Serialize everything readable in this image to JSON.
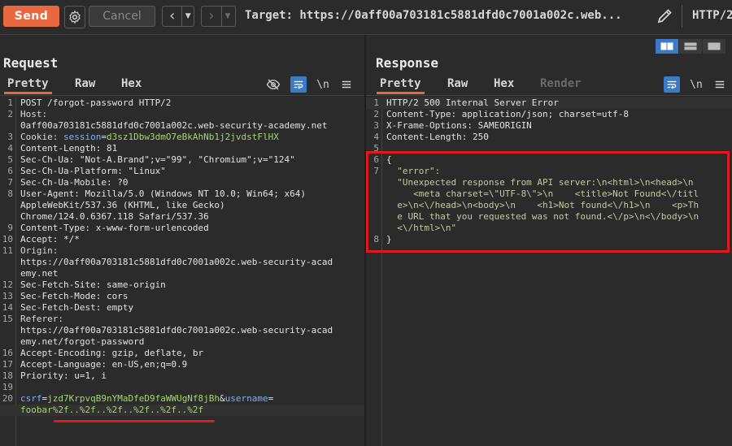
{
  "toolbar": {
    "send_label": "Send",
    "cancel_label": "Cancel",
    "target": "Target: https://0aff00a703181c5881dfd0c7001a002c.web...",
    "http_version": "HTTP/2"
  },
  "request": {
    "title": "Request",
    "tabs": [
      "Pretty",
      "Raw",
      "Hex"
    ],
    "newline_label": "\\n",
    "lines": [
      {
        "n": "1",
        "parts": [
          {
            "t": "POST /forgot-password HTTP/2",
            "c": "v"
          }
        ]
      },
      {
        "n": "2",
        "parts": [
          {
            "t": "Host:",
            "c": "k"
          }
        ]
      },
      {
        "n": "",
        "parts": [
          {
            "t": "0aff00a703181c5881dfd0c7001a002c.web-security-academy.net",
            "c": "v"
          }
        ]
      },
      {
        "n": "3",
        "parts": [
          {
            "t": "Cookie: ",
            "c": "k"
          },
          {
            "t": "session",
            "c": "b"
          },
          {
            "t": "=",
            "c": "v"
          },
          {
            "t": "d3sz1Dbw3dmO7eBkAhNb1j2jvdstFlHX",
            "c": "g"
          }
        ]
      },
      {
        "n": "4",
        "parts": [
          {
            "t": "Content-Length: 81",
            "c": "v"
          }
        ]
      },
      {
        "n": "5",
        "parts": [
          {
            "t": "Sec-Ch-Ua: \"Not-A.Brand\";v=\"99\", \"Chromium\";v=\"124\"",
            "c": "v"
          }
        ]
      },
      {
        "n": "6",
        "parts": [
          {
            "t": "Sec-Ch-Ua-Platform: \"Linux\"",
            "c": "v"
          }
        ]
      },
      {
        "n": "7",
        "parts": [
          {
            "t": "Sec-Ch-Ua-Mobile: ?0",
            "c": "v"
          }
        ]
      },
      {
        "n": "8",
        "parts": [
          {
            "t": "User-Agent: Mozilla/5.0 (Windows NT 10.0; Win64; x64)",
            "c": "v"
          }
        ]
      },
      {
        "n": "",
        "parts": [
          {
            "t": "AppleWebKit/537.36 (KHTML, like Gecko)",
            "c": "v"
          }
        ]
      },
      {
        "n": "",
        "parts": [
          {
            "t": "Chrome/124.0.6367.118 Safari/537.36",
            "c": "v"
          }
        ]
      },
      {
        "n": "9",
        "parts": [
          {
            "t": "Content-Type: x-www-form-urlencoded",
            "c": "v"
          }
        ]
      },
      {
        "n": "10",
        "parts": [
          {
            "t": "Accept: */*",
            "c": "v"
          }
        ]
      },
      {
        "n": "11",
        "parts": [
          {
            "t": "Origin:",
            "c": "k"
          }
        ]
      },
      {
        "n": "",
        "parts": [
          {
            "t": "https://0aff00a703181c5881dfd0c7001a002c.web-security-acad",
            "c": "v"
          }
        ]
      },
      {
        "n": "",
        "parts": [
          {
            "t": "emy.net",
            "c": "v"
          }
        ]
      },
      {
        "n": "12",
        "parts": [
          {
            "t": "Sec-Fetch-Site: same-origin",
            "c": "v"
          }
        ]
      },
      {
        "n": "13",
        "parts": [
          {
            "t": "Sec-Fetch-Mode: cors",
            "c": "v"
          }
        ]
      },
      {
        "n": "14",
        "parts": [
          {
            "t": "Sec-Fetch-Dest: empty",
            "c": "v"
          }
        ]
      },
      {
        "n": "15",
        "parts": [
          {
            "t": "Referer:",
            "c": "k"
          }
        ]
      },
      {
        "n": "",
        "parts": [
          {
            "t": "https://0aff00a703181c5881dfd0c7001a002c.web-security-acad",
            "c": "v"
          }
        ]
      },
      {
        "n": "",
        "parts": [
          {
            "t": "emy.net/forgot-password",
            "c": "v"
          }
        ]
      },
      {
        "n": "16",
        "parts": [
          {
            "t": "Accept-Encoding: gzip, deflate, br",
            "c": "v"
          }
        ]
      },
      {
        "n": "17",
        "parts": [
          {
            "t": "Accept-Language: en-US,en;q=0.9",
            "c": "v"
          }
        ]
      },
      {
        "n": "18",
        "parts": [
          {
            "t": "Priority: u=1, i",
            "c": "v"
          }
        ]
      },
      {
        "n": "19",
        "parts": []
      },
      {
        "n": "20",
        "parts": [
          {
            "t": "csrf",
            "c": "b"
          },
          {
            "t": "=",
            "c": "v"
          },
          {
            "t": "jzd7KrpvqB9nYMaDfeD9faWWUgNf8jBh",
            "c": "g"
          },
          {
            "t": "&",
            "c": "v"
          },
          {
            "t": "username",
            "c": "b"
          },
          {
            "t": "=",
            "c": "v"
          }
        ]
      },
      {
        "n": "",
        "parts": [
          {
            "t": "foobar%2f..%2f..%2f..%2f..%2f..%2f",
            "c": "g"
          }
        ],
        "hl": true
      }
    ]
  },
  "response": {
    "title": "Response",
    "tabs": [
      "Pretty",
      "Raw",
      "Hex",
      "Render"
    ],
    "newline_label": "\\n",
    "lines": [
      {
        "n": "1",
        "parts": [
          {
            "t": "HTTP/2 500 Internal Server Error",
            "c": "v"
          }
        ],
        "hl": true
      },
      {
        "n": "2",
        "parts": [
          {
            "t": "Content-Type: application/json; charset=utf-8",
            "c": "v"
          }
        ]
      },
      {
        "n": "3",
        "parts": [
          {
            "t": "X-Frame-Options: SAMEORIGIN",
            "c": "v"
          }
        ]
      },
      {
        "n": "4",
        "parts": [
          {
            "t": "Content-Length: 250",
            "c": "v"
          }
        ]
      },
      {
        "n": "5",
        "parts": []
      },
      {
        "n": "6",
        "parts": [
          {
            "t": "{",
            "c": "v"
          }
        ]
      },
      {
        "n": "7",
        "parts": [
          {
            "t": "  \"error\":",
            "c": "s"
          }
        ]
      },
      {
        "n": "",
        "parts": [
          {
            "t": "  \"Unexpected response from API server:\\n<html>\\n<head>\\n",
            "c": "s"
          }
        ]
      },
      {
        "n": "",
        "parts": [
          {
            "t": "     <meta charset=\\\"UTF-8\\\">\\n    <title>Not Found<\\/titl",
            "c": "s"
          }
        ]
      },
      {
        "n": "",
        "parts": [
          {
            "t": "  e>\\n<\\/head>\\n<body>\\n    <h1>Not found<\\/h1>\\n    <p>Th",
            "c": "s"
          }
        ]
      },
      {
        "n": "",
        "parts": [
          {
            "t": "  e URL that you requested was not found.<\\/p>\\n<\\/body>\\n",
            "c": "s"
          }
        ]
      },
      {
        "n": "",
        "parts": [
          {
            "t": "  <\\/html>\\n\"",
            "c": "s"
          }
        ]
      },
      {
        "n": "8",
        "parts": [
          {
            "t": "}",
            "c": "v"
          }
        ]
      }
    ]
  }
}
